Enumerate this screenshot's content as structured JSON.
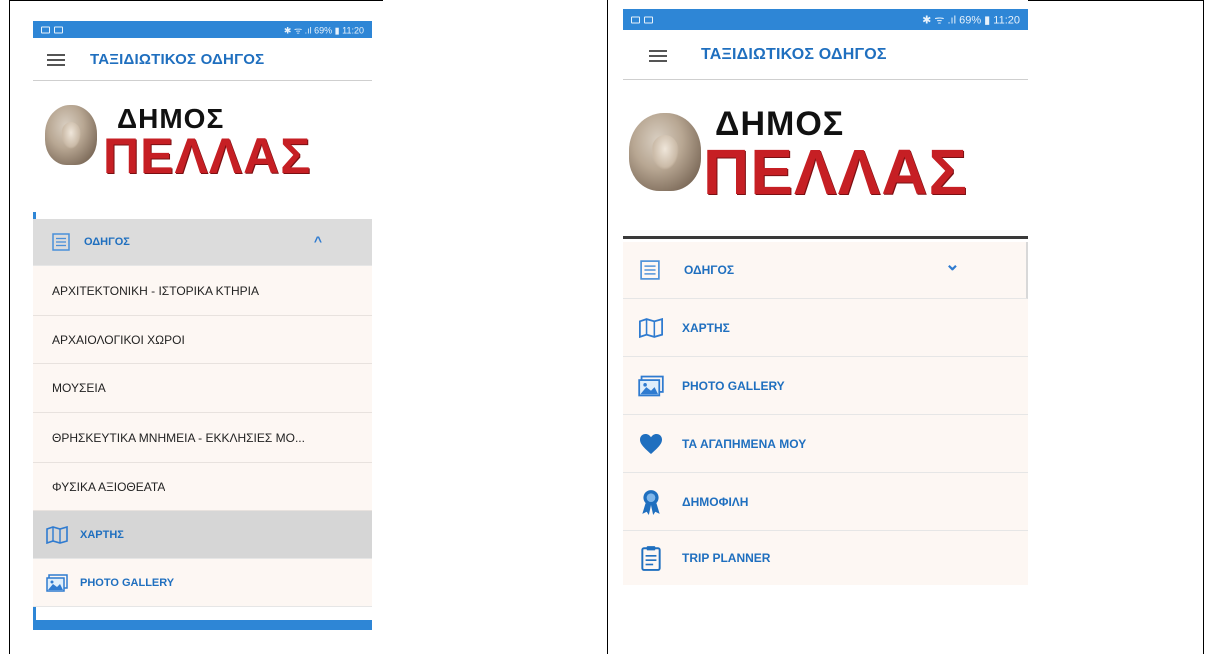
{
  "status_bar": {
    "right_text": "✱ ᯤ .ıl 69% ▮ 11:20"
  },
  "app_bar": {
    "title": "ΤΑΞΙΔΙΩΤΙΚΟΣ ΟΔΗΓΟΣ"
  },
  "logo": {
    "small_text": "ΔΗΜΟΣ",
    "big_text": "ΠΕΛΛΑΣ"
  },
  "left_screen": {
    "expanded_section": {
      "label": "ΟΔΗΓΟΣ",
      "icon": "list-icon",
      "chevron": "^"
    },
    "sub_items": [
      "ΑΡΧΙΤΕΚΤΟΝΙΚΗ - ΙΣΤΟΡΙΚΑ ΚΤΗΡΙΑ",
      "ΑΡΧΑΙΟΛΟΓΙΚΟΙ ΧΩΡΟΙ",
      "ΜΟΥΣΕΙΑ",
      "ΘΡΗΣΚΕΥΤΙΚΑ ΜΝΗΜΕΙΑ - ΕΚΚΛΗΣΙΕΣ ΜΟ...",
      "ΦΥΣΙΚΑ ΑΞΙΟΘΕΑΤΑ"
    ],
    "items": [
      {
        "label": "ΧΑΡΤΗΣ",
        "icon": "map-icon"
      },
      {
        "label": "PHOTO GALLERY",
        "icon": "photo-icon"
      }
    ]
  },
  "right_screen": {
    "section": {
      "label": "ΟΔΗΓΟΣ",
      "icon": "list-icon",
      "chevron": "⌄"
    },
    "items": [
      {
        "label": "ΧΑΡΤΗΣ",
        "icon": "map-icon"
      },
      {
        "label": "PHOTO GALLERY",
        "icon": "photo-icon"
      },
      {
        "label": "ΤΑ ΑΓΑΠΗΜΕΝΑ ΜΟΥ",
        "icon": "heart-icon"
      },
      {
        "label": "ΔΗΜΟΦΙΛΗ",
        "icon": "award-icon"
      },
      {
        "label": "TRIP PLANNER",
        "icon": "clipboard-icon"
      }
    ]
  },
  "colors": {
    "accent": "#2e86d6",
    "label_blue": "#1f6fbf",
    "logo_red": "#c61f24"
  }
}
